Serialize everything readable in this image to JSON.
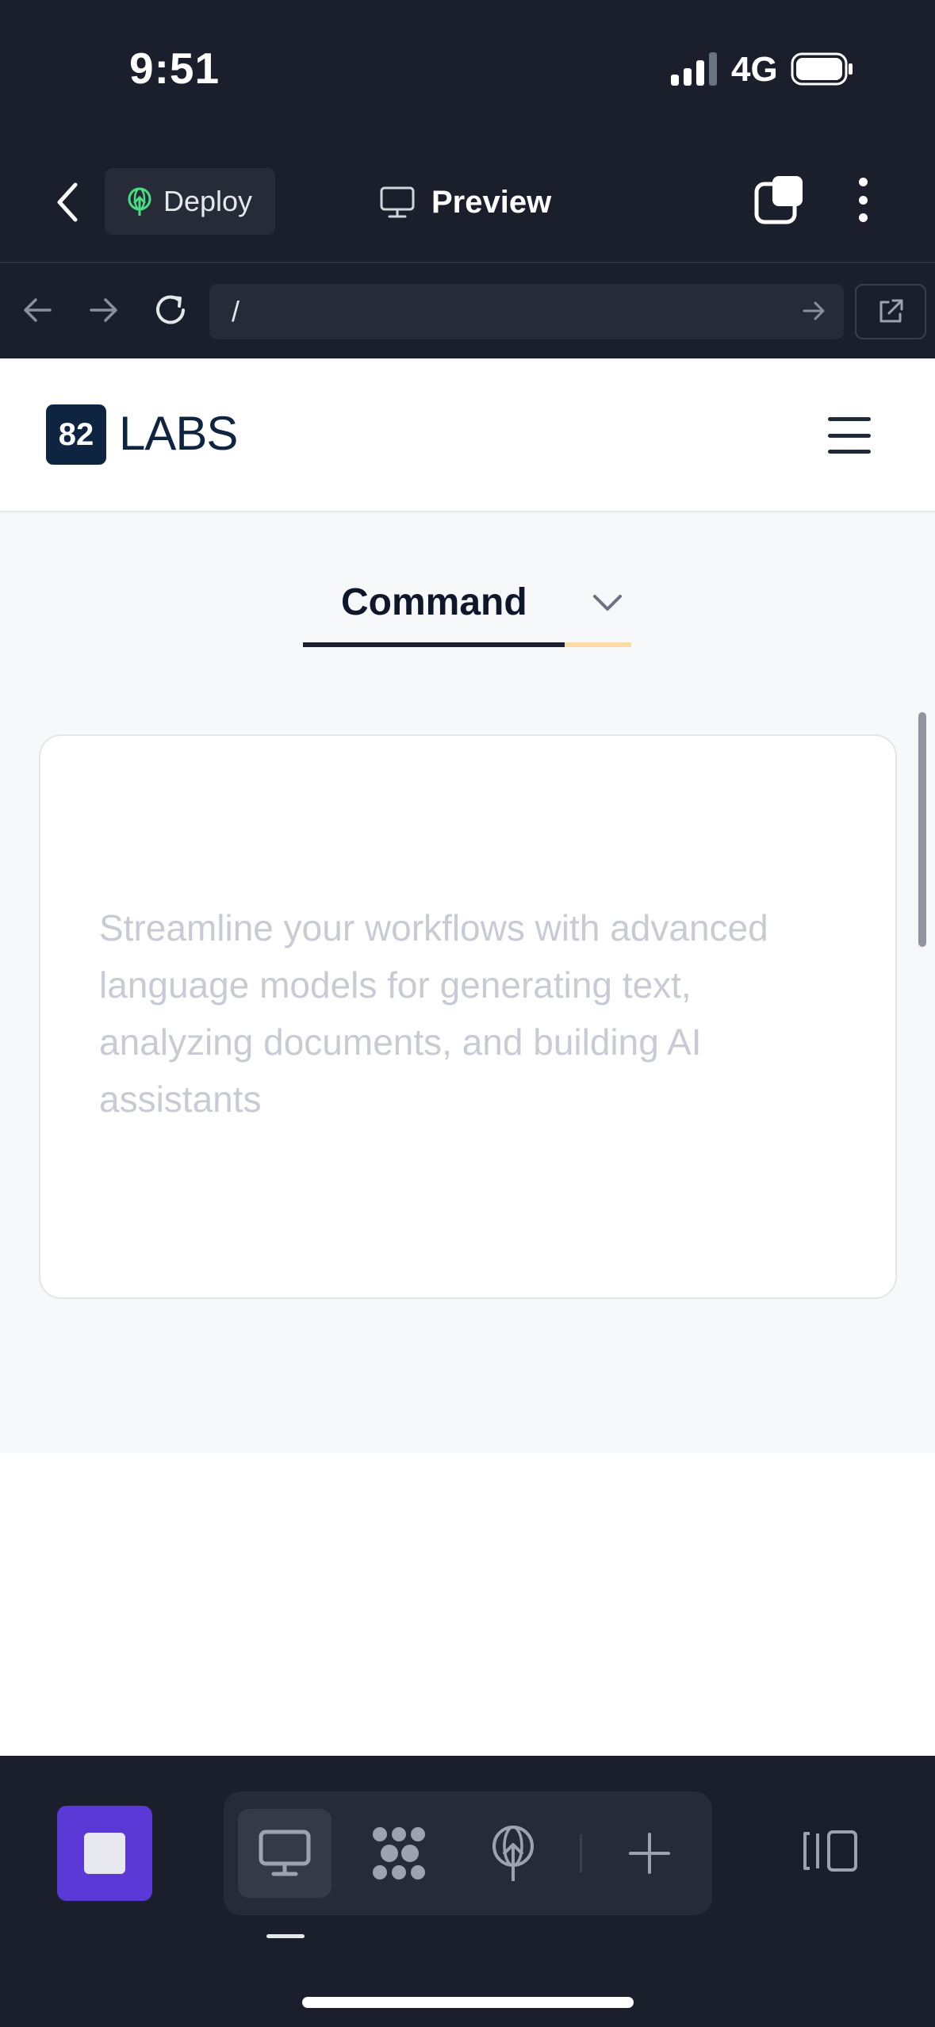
{
  "status_bar": {
    "time": "9:51",
    "network": "4G"
  },
  "nav": {
    "deploy_label": "Deploy",
    "preview_label": "Preview"
  },
  "url_bar": {
    "path": "/"
  },
  "site": {
    "logo_badge": "82",
    "logo_text": "LABS",
    "tab_label": "Command",
    "card_text": "Streamline your workflows with advanced language models for generating text, analyzing documents, and building AI assistants"
  },
  "colors": {
    "chrome_background": "#1b1f2b",
    "stop_button": "#5b39d6",
    "logo_navy": "#0f2440",
    "tab_accent": "#fcd9a8",
    "deploy_icon_green": "#4ade80"
  },
  "icons": {
    "back": "chevron-left-icon",
    "deploy": "globe-upload-icon",
    "preview": "monitor-icon",
    "tabs": "tabs-icon",
    "more": "more-vertical-icon",
    "browser_back": "arrow-left-icon",
    "browser_forward": "arrow-right-icon",
    "reload": "reload-icon",
    "go": "arrow-right-icon",
    "external": "external-link-icon",
    "menu": "hamburger-icon",
    "tool_desktop": "monitor-icon",
    "tool_components": "cluster-icon",
    "tool_deploy": "globe-upload-icon",
    "tool_add": "plus-icon",
    "panel": "panel-toggle-icon"
  }
}
